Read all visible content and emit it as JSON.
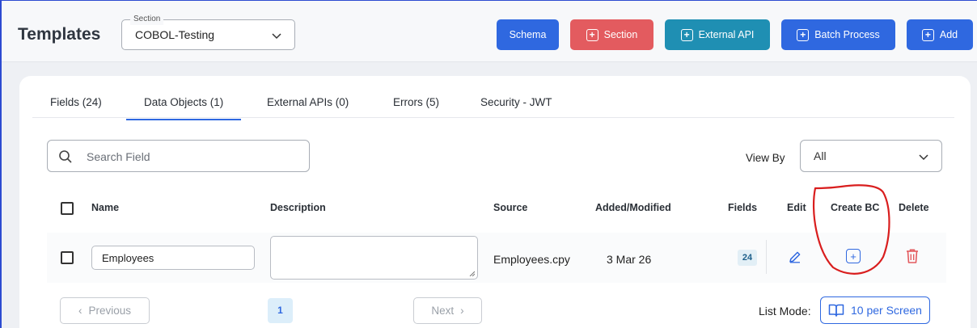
{
  "header": {
    "title": "Templates",
    "section_label": "Section",
    "section_value": "COBOL-Testing",
    "buttons": {
      "schema": "Schema",
      "section": "Section",
      "external_api": "External API",
      "batch_process": "Batch Process",
      "add": "Add"
    }
  },
  "tabs": [
    {
      "label": "Fields (24)"
    },
    {
      "label": "Data Objects (1)"
    },
    {
      "label": "External APIs (0)"
    },
    {
      "label": "Errors (5)"
    },
    {
      "label": "Security - JWT"
    }
  ],
  "active_tab": "Data Objects (1)",
  "search": {
    "placeholder": "Search Field"
  },
  "view_by": {
    "label": "View By",
    "value": "All"
  },
  "table": {
    "headers": {
      "name": "Name",
      "description": "Description",
      "source": "Source",
      "added": "Added/Modified",
      "fields": "Fields",
      "edit": "Edit",
      "create_bc": "Create BC",
      "delete": "Delete"
    },
    "rows": [
      {
        "name": "Employees",
        "description": "",
        "source": "Employees.cpy",
        "added": "3 Mar 26",
        "fields": "24"
      }
    ]
  },
  "pagination": {
    "previous": "Previous",
    "next": "Next",
    "current_page": "1",
    "list_mode_label": "List Mode:",
    "per_screen": "10 per Screen"
  },
  "colors": {
    "primary": "#2f68e0",
    "danger": "#e35b5f",
    "teal": "#1f8fb3",
    "annotation": "#d91e1e"
  }
}
